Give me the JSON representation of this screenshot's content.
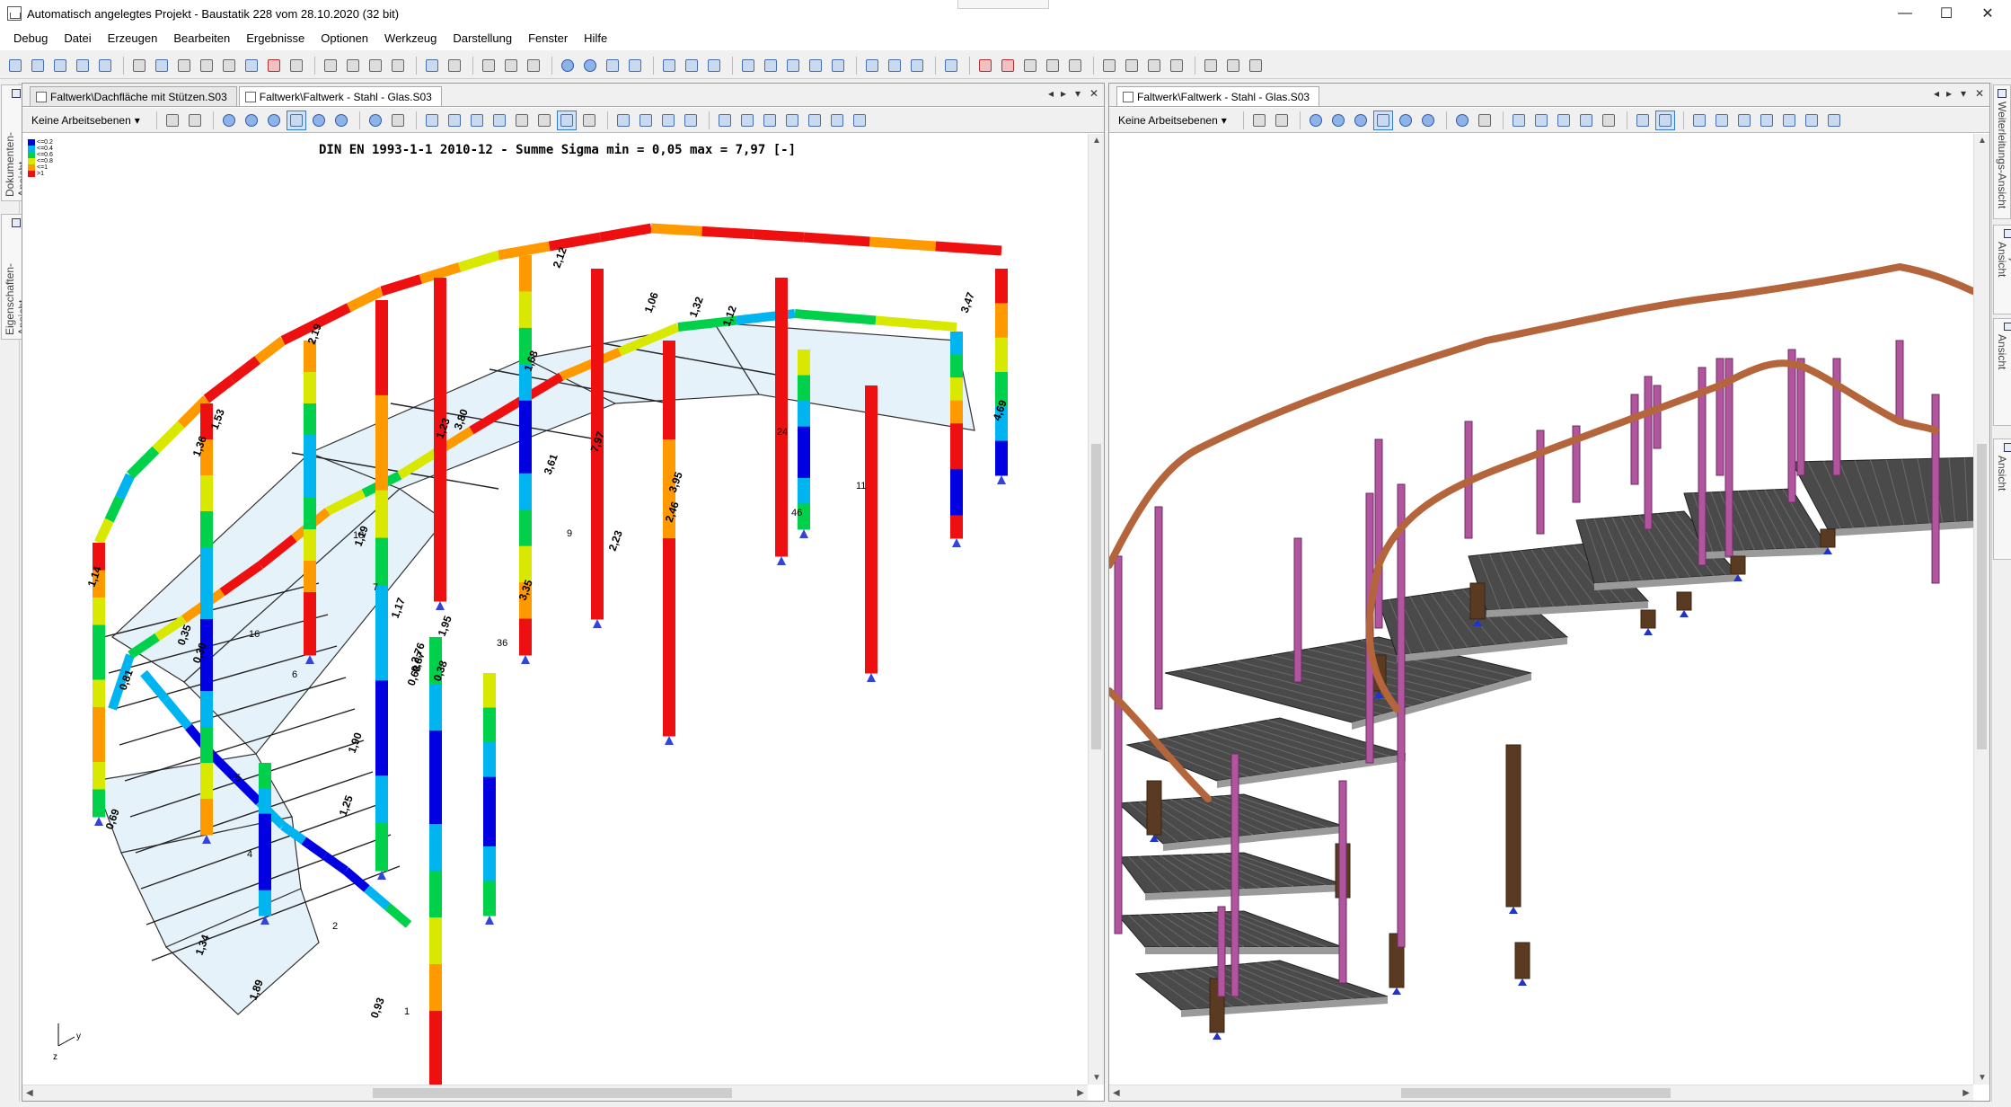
{
  "window": {
    "title": "Automatisch angelegtes Projekt - Baustatik 228 vom 28.10.2020 (32 bit)",
    "controls": {
      "minimize": "—",
      "maximize": "☐",
      "close": "✕"
    }
  },
  "menu": [
    "Debug",
    "Datei",
    "Erzeugen",
    "Bearbeiten",
    "Ergebnisse",
    "Optionen",
    "Werkzeug",
    "Darstellung",
    "Fenster",
    "Hilfe"
  ],
  "side_left": {
    "tabs": [
      "Dokumenten-Ansicht",
      "Eigenschaften-Ansicht"
    ]
  },
  "side_right": {
    "tabs": [
      "Weiterleitungs-Ansicht",
      "Projekt-Ansicht",
      "Lastfallfilter-Ansicht",
      "Sichtbarkeits-Ansicht"
    ]
  },
  "left_pane": {
    "tabs": [
      "Faltwerk\\Dachfläche mit Stützen.S03",
      "Faltwerk\\Faltwerk - Stahl - Glas.S03"
    ],
    "active_tab": 1,
    "workplane": "Keine Arbeitsebenen",
    "plot_title": "DIN EN 1993-1-1 2010-12 - Summe Sigma min = 0,05 max = 7,97 [-]",
    "legend": [
      {
        "label": "<=0.2",
        "color": "#0000e0"
      },
      {
        "label": "<=0.4",
        "color": "#00b4f0"
      },
      {
        "label": "<=0.6",
        "color": "#00d04a"
      },
      {
        "label": "<=0.8",
        "color": "#d8e800"
      },
      {
        "label": "<=1",
        "color": "#ff9900"
      },
      {
        "label": ">1",
        "color": "#ee1010"
      }
    ],
    "member_labels": [
      "1,14",
      "1,36",
      "1,53",
      "2,19",
      "2,12",
      "1,23",
      "3,80",
      "1,68",
      "7,97",
      "1,06",
      "1,32",
      "1,12",
      "3,47",
      "4,69",
      "3,61",
      "3,95",
      "2,46",
      "2,23",
      "3,35",
      "1,95",
      "2,76",
      "1,17",
      "1,19",
      "0,87",
      "0,68",
      "0,38",
      "0,35",
      "0,30",
      "0,81",
      "0,69",
      "1,90",
      "1,25",
      "1,34",
      "1,89",
      "0,93"
    ],
    "plate_labels": [
      "1",
      "2",
      "4",
      "5",
      "6",
      "7",
      "9",
      "11",
      "16",
      "18",
      "24",
      "36",
      "46"
    ],
    "axis": {
      "y": "y",
      "z": "z"
    }
  },
  "right_pane": {
    "tabs": [
      "Faltwerk\\Faltwerk - Stahl - Glas.S03"
    ],
    "workplane": "Keine Arbeitsebenen"
  }
}
